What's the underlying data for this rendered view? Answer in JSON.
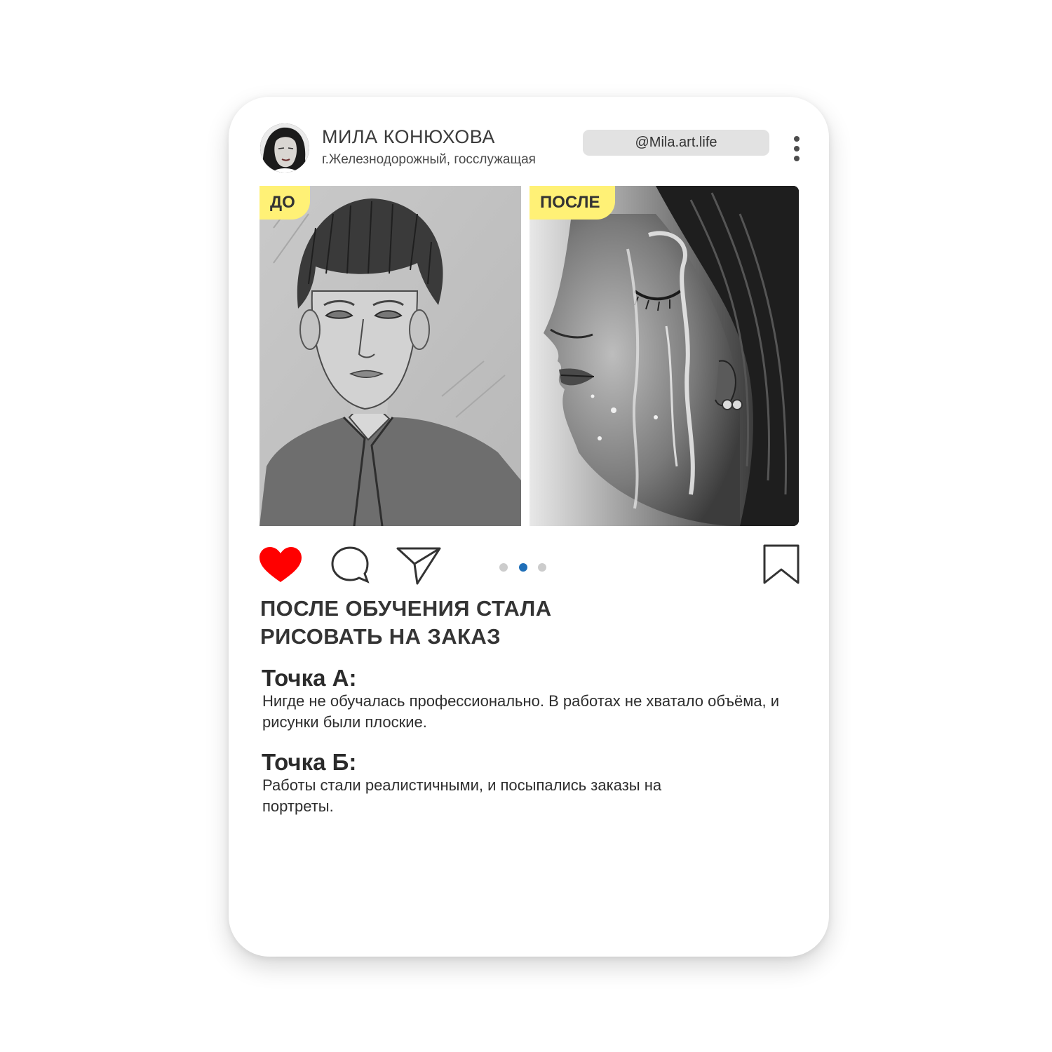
{
  "profile": {
    "name": "МИЛА КОНЮХОВА",
    "subtitle": "г.Железнодорожный, госслужащая",
    "handle": "@Mila.art.life"
  },
  "post": {
    "before_label": "ДО",
    "after_label": "ПОСЛЕ",
    "carousel": {
      "count": 3,
      "active_index": 1
    },
    "liked": true,
    "colors": {
      "like": "#ff0000",
      "tag_background": "#fff176",
      "carousel_active": "#1f6fb8",
      "carousel_inactive": "#cccccc"
    },
    "actions": {
      "like_icon": "heart-icon",
      "comment_icon": "comment-icon",
      "share_icon": "send-icon",
      "save_icon": "bookmark-icon",
      "menu_icon": "more-vertical-icon"
    }
  },
  "content": {
    "headline_line1": "ПОСЛЕ ОБУЧЕНИЯ СТАЛА",
    "headline_line2": "РИСОВАТЬ НА ЗАКАЗ",
    "point_a_title": "Точка А:",
    "point_a_text": "Нигде не обучалась профессионально. В работах не хватало объёма, и рисунки были плоские.",
    "point_b_title": "Точка Б:",
    "point_b_text": "Работы стали реалистичными, и посыпались заказы на портреты."
  }
}
